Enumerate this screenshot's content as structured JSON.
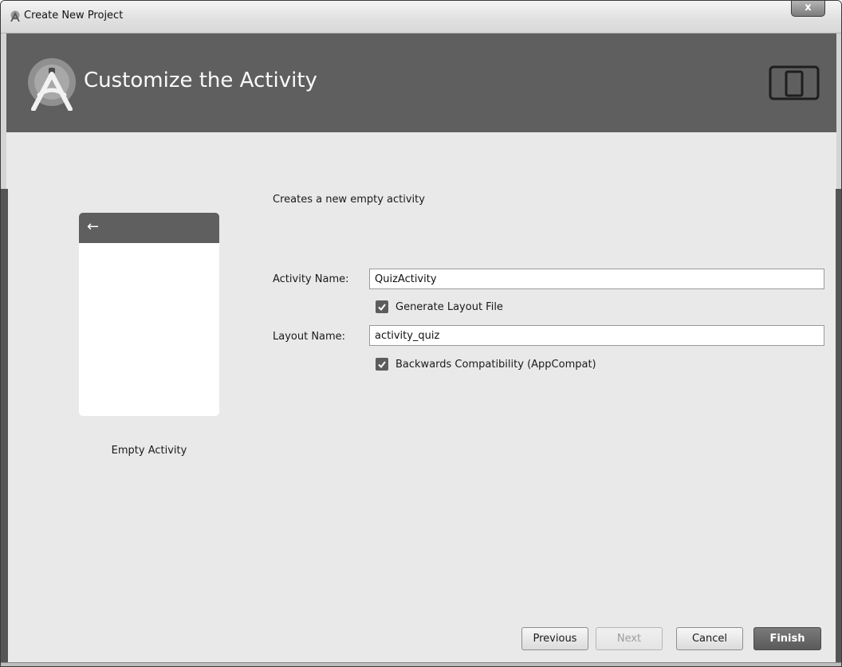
{
  "window": {
    "title": "Create New Project",
    "close_label": "x"
  },
  "header": {
    "title": "Customize the Activity"
  },
  "template": {
    "name": "Empty Activity",
    "description": "Creates a new empty activity"
  },
  "form": {
    "activity_name": {
      "label": "Activity Name:",
      "value": "QuizActivity"
    },
    "generate_layout": {
      "label": "Generate Layout File",
      "checked": true
    },
    "layout_name": {
      "label": "Layout Name:",
      "value": "activity_quiz"
    },
    "backwards_compat": {
      "label": "Backwards Compatibility (AppCompat)",
      "checked": true
    }
  },
  "buttons": {
    "previous": "Previous",
    "next": "Next",
    "cancel": "Cancel",
    "finish": "Finish"
  },
  "icons": {
    "app": "android-studio-icon",
    "device": "device-form-factor-icon",
    "back": "back-arrow-icon",
    "check": "check-icon"
  },
  "colors": {
    "header_bg": "#5f5f5f",
    "content_bg": "#e9e9e9",
    "finish_bg": "#6a6a6a"
  }
}
